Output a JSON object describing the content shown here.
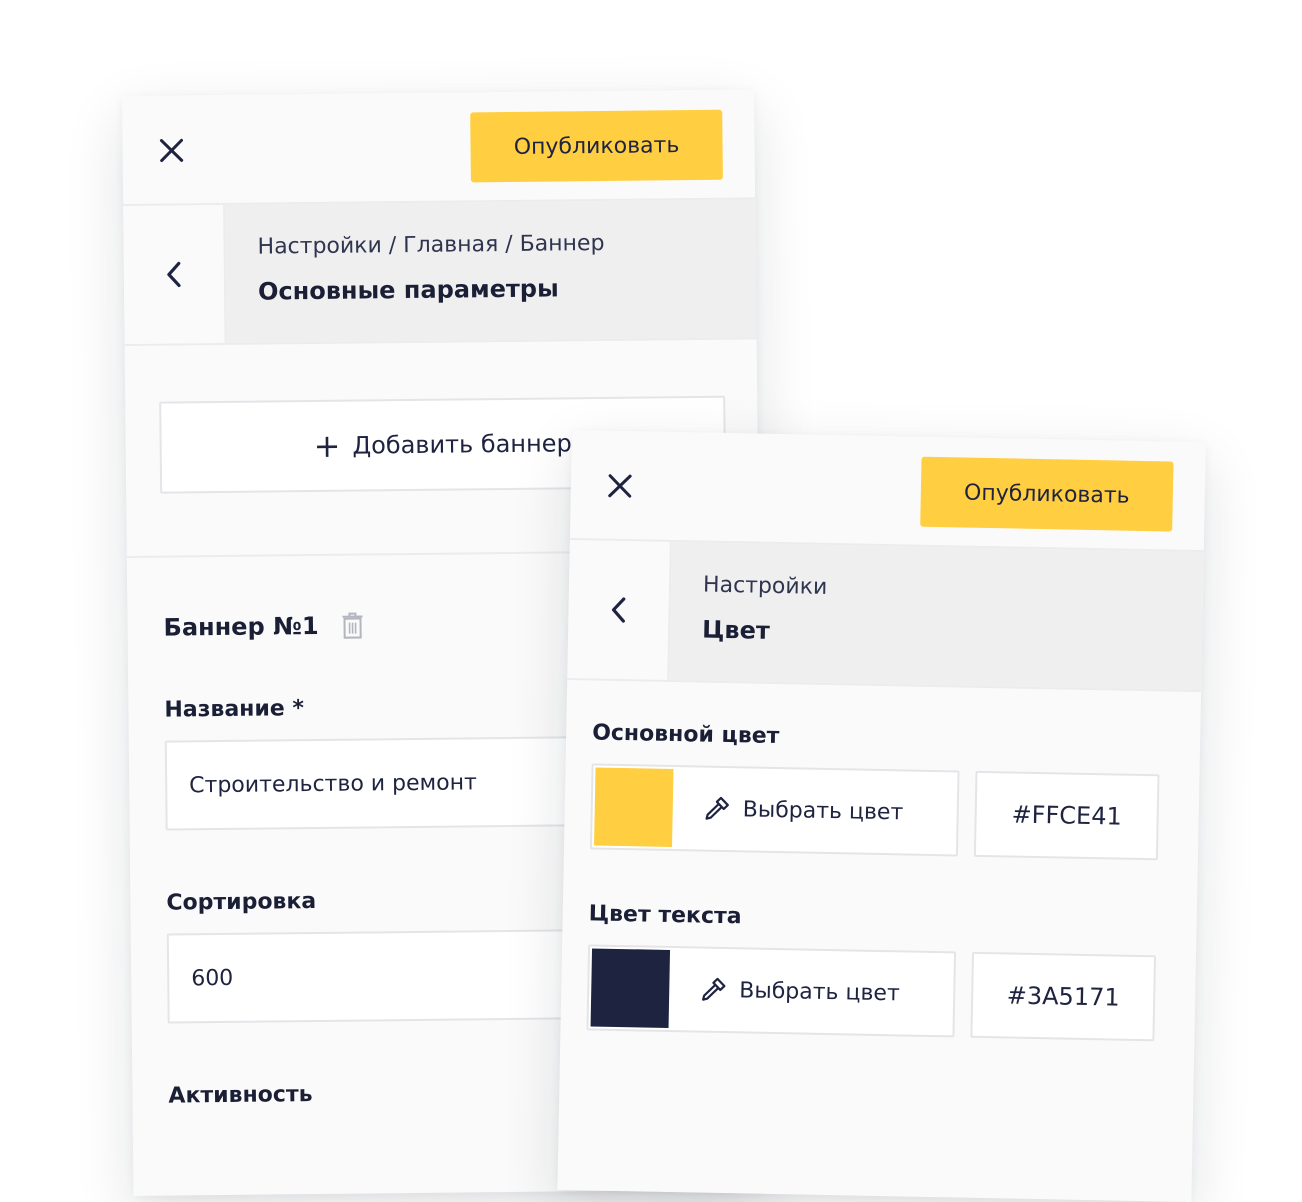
{
  "panel_main": {
    "publish_label": "Опубликовать",
    "breadcrumb": "Настройки / Главная / Баннер",
    "title": "Основные параметры",
    "add_banner_label": "Добавить баннер",
    "banner_title": "Баннер №1",
    "fields": {
      "name_label": "Название *",
      "name_value": "Строительство и ремонт",
      "sort_label": "Сортировка",
      "sort_value": "600",
      "activity_label": "Активность"
    }
  },
  "panel_color": {
    "publish_label": "Опубликовать",
    "breadcrumb": "Настройки",
    "title": "Цвет",
    "main_color": {
      "label": "Основной цвет",
      "pick_label": "Выбрать цвет",
      "hex": "#FFCE41",
      "swatch": "#FFCE41"
    },
    "text_color": {
      "label": "Цвет текста",
      "pick_label": "Выбрать цвет",
      "hex": "#3A5171",
      "swatch": "#1E2340"
    }
  },
  "colors": {
    "accent": "#FFCE41",
    "text_dark": "#1E2340",
    "crumb_bg": "#EFEFF0"
  },
  "icons": [
    "close-icon",
    "chevron-left-icon",
    "plus-icon",
    "trash-icon",
    "eyedropper-icon"
  ]
}
